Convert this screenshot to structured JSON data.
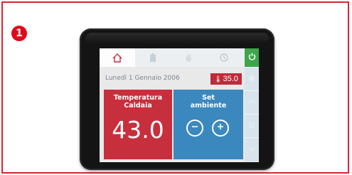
{
  "step": {
    "number": "1"
  },
  "tabs": [
    {
      "icon": "home-icon",
      "active": true
    },
    {
      "icon": "boiler-icon",
      "active": false
    },
    {
      "icon": "flame-icon",
      "active": false
    },
    {
      "icon": "clock-icon",
      "active": false
    }
  ],
  "power": {
    "icon": "power-icon"
  },
  "status": {
    "date": "Lunedì 1 Gennaio 2006",
    "temperature": "35.0",
    "temperature_icon": "thermometer-icon"
  },
  "boiler_panel": {
    "title_line1": "Temperatura",
    "title_line2": "Caldaia",
    "value": "43.0"
  },
  "set_panel": {
    "title_line1": "Set",
    "title_line2": "ambiente"
  },
  "colors": {
    "frame": "#d7262f",
    "boiler_panel": "#c82f3d",
    "set_panel": "#3b88bf",
    "power": "#3ea54b"
  }
}
